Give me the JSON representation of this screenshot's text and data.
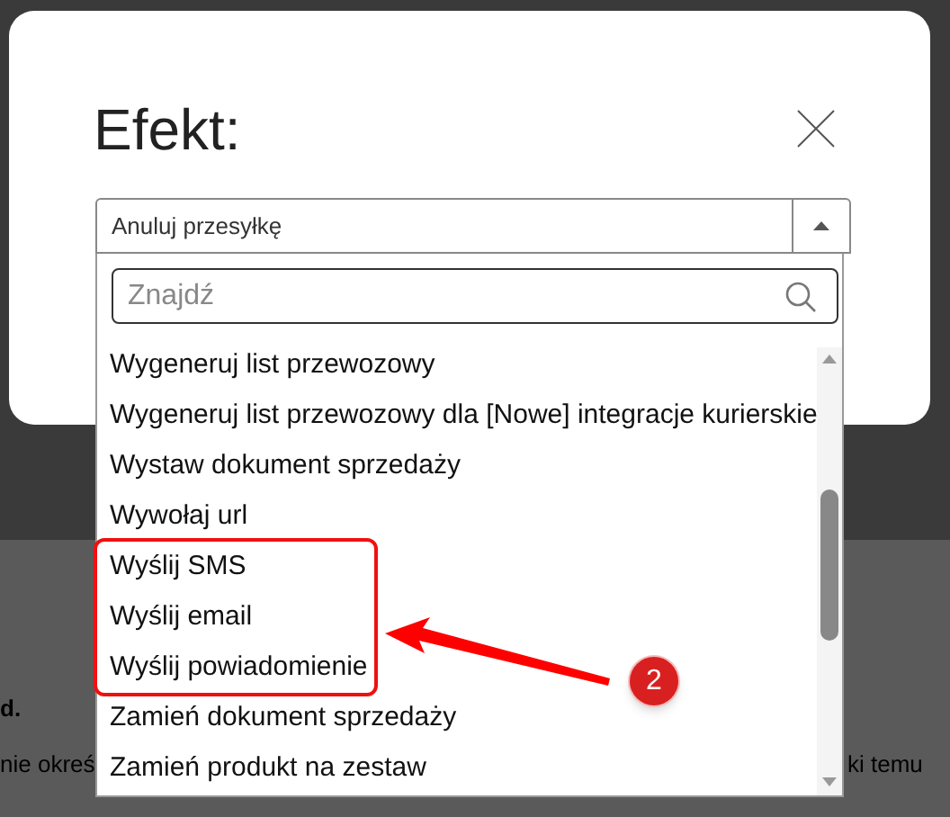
{
  "background": {
    "texts": [
      {
        "text": "d.",
        "kind": "heading"
      },
      {
        "text": "nie okreś",
        "kind": "body"
      },
      {
        "text": "ki temu",
        "kind": "body"
      }
    ]
  },
  "dialog": {
    "title": "Efekt:",
    "select": {
      "value": "Anuluj przesyłkę",
      "expanded": true
    },
    "search": {
      "placeholder": "Znajdź"
    },
    "options": [
      {
        "label": "Wygeneruj list przewozowy"
      },
      {
        "label": "Wygeneruj list przewozowy dla [Nowe] integracje kurierskie"
      },
      {
        "label": "Wystaw dokument sprzedaży"
      },
      {
        "label": "Wywołaj url"
      },
      {
        "label": "Wyślij SMS"
      },
      {
        "label": "Wyślij email"
      },
      {
        "label": "Wyślij powiadomienie"
      },
      {
        "label": "Zamień dokument sprzedaży"
      },
      {
        "label": "Zamień produkt na zestaw"
      }
    ]
  },
  "annotation": {
    "badge": "2"
  }
}
